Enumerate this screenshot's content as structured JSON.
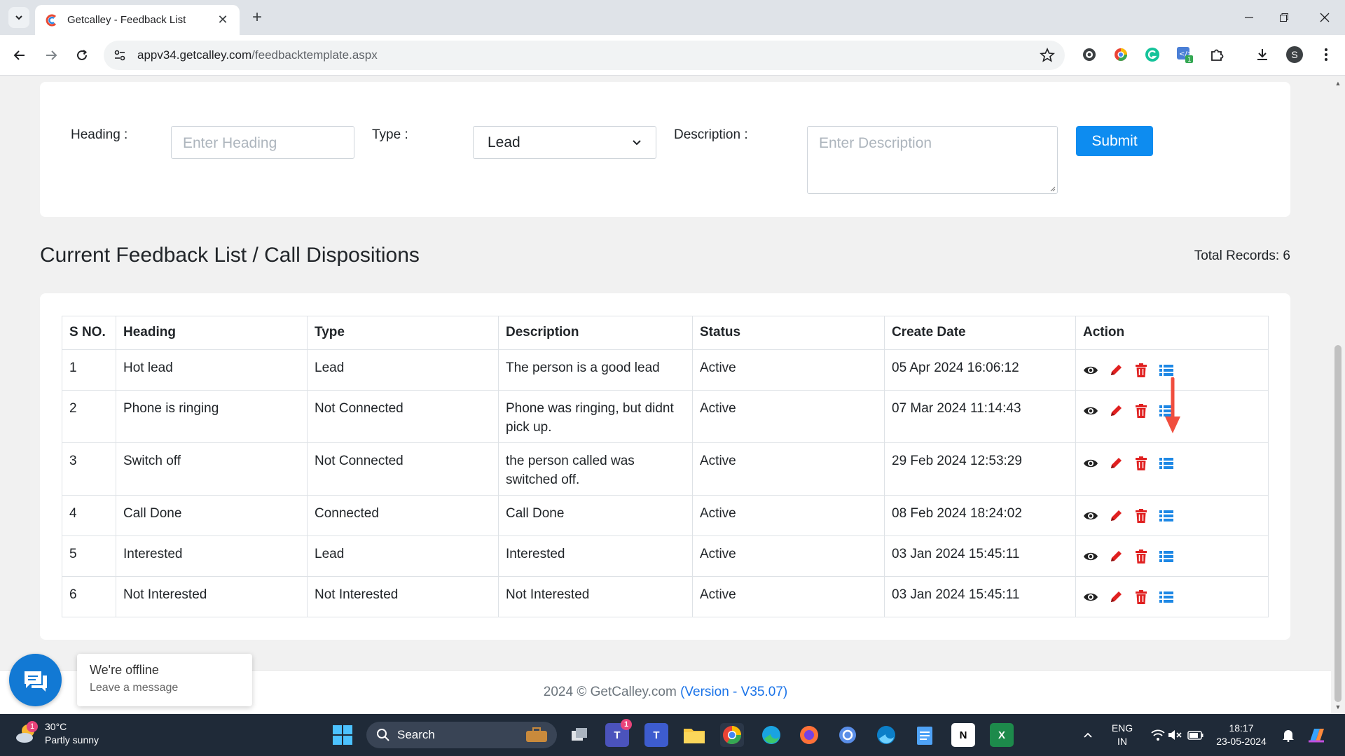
{
  "browser": {
    "tab_title": "Getcalley - Feedback List",
    "url_host": "appv34.getcalley.com",
    "url_path": "/feedbacktemplate.aspx",
    "profile_initial": "S"
  },
  "form": {
    "heading_label": "Heading :",
    "heading_placeholder": "Enter Heading",
    "type_label": "Type :",
    "type_selected": "Lead",
    "description_label": "Description :",
    "description_placeholder": "Enter Description",
    "submit_label": "Submit"
  },
  "list": {
    "title": "Current Feedback List / Call Dispositions",
    "total_records": "Total Records: 6",
    "columns": [
      "S NO.",
      "Heading",
      "Type",
      "Description",
      "Status",
      "Create Date",
      "Action"
    ],
    "rows": [
      {
        "sno": "1",
        "heading": "Hot lead",
        "type": "Lead",
        "description": "The person is a good lead",
        "status": "Active",
        "date": "05 Apr 2024 16:06:12"
      },
      {
        "sno": "2",
        "heading": "Phone is ringing",
        "type": "Not Connected",
        "description": "Phone was ringing, but didnt pick up.",
        "status": "Active",
        "date": "07 Mar 2024 11:14:43"
      },
      {
        "sno": "3",
        "heading": "Switch off",
        "type": "Not Connected",
        "description": "the person called was switched off.",
        "status": "Active",
        "date": "29 Feb 2024 12:53:29"
      },
      {
        "sno": "4",
        "heading": "Call Done",
        "type": "Connected",
        "description": "Call Done",
        "status": "Active",
        "date": "08 Feb 2024 18:24:02"
      },
      {
        "sno": "5",
        "heading": "Interested",
        "type": "Lead",
        "description": "Interested",
        "status": "Active",
        "date": "03 Jan 2024 15:45:11"
      },
      {
        "sno": "6",
        "heading": "Not Interested",
        "type": "Not Interested",
        "description": "Not Interested",
        "status": "Active",
        "date": "03 Jan 2024 15:45:11"
      }
    ]
  },
  "footer": {
    "copyright": "2024 © GetCalley.com",
    "version": "(Version - V35.07)"
  },
  "chat": {
    "title": "We're offline",
    "subtitle": "Leave a message"
  },
  "taskbar": {
    "temperature": "30°C",
    "condition": "Partly sunny",
    "weather_badge": "1",
    "search_label": "Search",
    "teams_badge": "1",
    "lang_line1": "ENG",
    "lang_line2": "IN",
    "time": "18:17",
    "date": "23-05-2024"
  },
  "colors": {
    "submit_button": "#0d8cf0",
    "action_view": "#222222",
    "action_edit": "#e02020",
    "action_delete": "#e02020",
    "action_list": "#1e88e5",
    "annotation_arrow": "#f04e3e"
  }
}
